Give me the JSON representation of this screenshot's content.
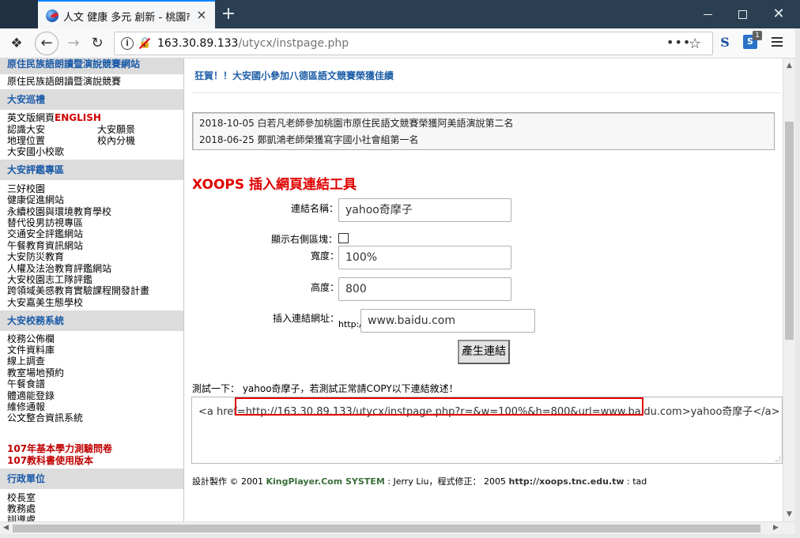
{
  "browser": {
    "tab_title": "人文 健康 多元 創新 - 桃園市八德區大安國民小學",
    "tab_close": "×",
    "new_tab": "+",
    "win_close": "✕",
    "url_host": "163.30.89.133",
    "url_path": "/utycx/instpage.php",
    "url_more": "•••",
    "bookmark_star": "☆",
    "ext_s": "S",
    "ext_badge": "1",
    "ext_label": "S"
  },
  "sidebar": {
    "top_partial_header": "原住民族語朗讀暨演說競賽網站",
    "top_item": "原住民族語朗讀暨演說競賽",
    "sections": [
      {
        "header": "大安巡禮"
      },
      {
        "header": "大安評鑑專區"
      },
      {
        "header": "大安校務系統"
      },
      {
        "header": "行政單位"
      }
    ],
    "english_prefix": "英文版網頁",
    "english_suffix": "ENGLISH",
    "tour_items": [
      "認識大安",
      "大安願景",
      "地理位置",
      "校內分機",
      "大安國小校歌"
    ],
    "eval_items": [
      "三好校園",
      "健康促進網站",
      "永續校園與環境教育學校",
      "替代役男訪視專區",
      "交通安全評鑑網站",
      "午餐教育資訊網站",
      "大安防災教育",
      "人權及法治教育評鑑網站",
      "大安校園志工隊評鑑",
      "跨領域美感教育實驗課程開發計畫",
      "大安嘉美生態學校"
    ],
    "system_items": [
      "校務公佈欄",
      "文件資料庫",
      "線上調查",
      "教室場地預約",
      "午餐食譜",
      "體適能登錄",
      "維修通報",
      "公文整合資訊系統"
    ],
    "red_items": [
      "107年基本學力測驗問卷",
      "107教科書使用版本"
    ],
    "admin_items": [
      "校長室",
      "教務處",
      "訓導處"
    ]
  },
  "main": {
    "headline": "狂賀！！大安國小參加八德區語文競賽榮獲佳績",
    "news": [
      "2018-10-05 白若凡老師參加桃園市原住民語文競賽榮獲阿美語演說第二名",
      "2018-06-25 鄭凱鴻老師榮獲寫字國小社會組第一名"
    ],
    "tool_title": "XOOPS 插入網頁連結工具",
    "form": {
      "name_label": "連結名稱：",
      "name_value": "yahoo奇摩子",
      "show_right_label": "顯示右側區塊：",
      "width_label": "寬度：",
      "width_value": "100%",
      "height_label": "高度：",
      "height_value": "800",
      "url_label": "插入連結網址：",
      "url_prefix": "http://",
      "url_value": "www.baidu.com",
      "submit_label": "產生連結"
    },
    "test_line": "測試一下： yahoo奇摩子，若測試正常請COPY以下連結敘述！",
    "code_text": "<a href=http://163.30.89.133/utycx/instpage.php?r=&w=100%&h=800&url=www.baidu.com>yahoo奇摩子</a>",
    "footer_prefix": "設計製作 © 2001 ",
    "footer_brand": "KingPlayer.Com SYSTEM",
    "footer_mid": " : Jerry Liu，程式修正： 2005 ",
    "footer_tool": "http://xoops.tnc.edu.tw",
    "footer_suffix": " : tad"
  }
}
